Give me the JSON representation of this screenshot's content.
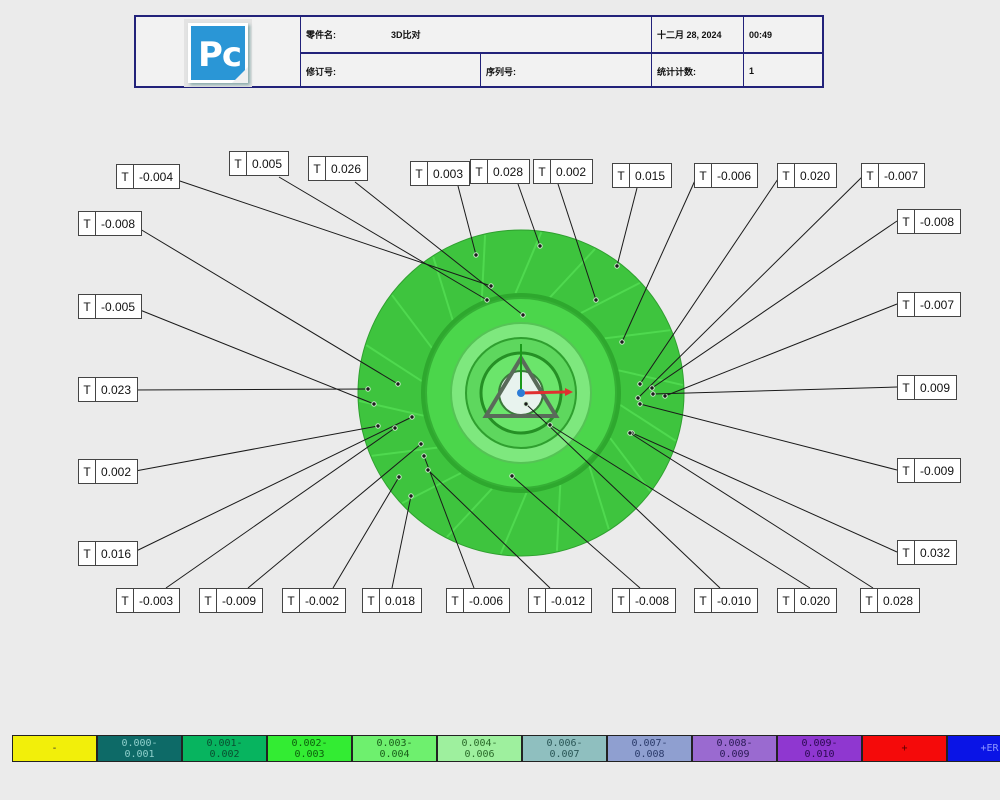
{
  "header": {
    "part_name_label": "零件名:",
    "part_name_value": "3D比对",
    "date": "十二月 28, 2024",
    "time": "00:49",
    "revision_label": "修订号:",
    "serial_label": "序列号:",
    "stat_count_label": "统计计数:",
    "stat_count_value": "1",
    "logo_text": "Pc"
  },
  "callouts": [
    {
      "t": "T",
      "value": "-0.004"
    },
    {
      "t": "T",
      "value": "0.005"
    },
    {
      "t": "T",
      "value": "0.026"
    },
    {
      "t": "T",
      "value": "0.003"
    },
    {
      "t": "T",
      "value": "0.028"
    },
    {
      "t": "T",
      "value": "0.002"
    },
    {
      "t": "T",
      "value": "0.015"
    },
    {
      "t": "T",
      "value": "-0.006"
    },
    {
      "t": "T",
      "value": "0.020"
    },
    {
      "t": "T",
      "value": "-0.007"
    },
    {
      "t": "T",
      "value": "-0.008"
    },
    {
      "t": "T",
      "value": "-0.008"
    },
    {
      "t": "T",
      "value": "-0.005"
    },
    {
      "t": "T",
      "value": "-0.007"
    },
    {
      "t": "T",
      "value": "0.023"
    },
    {
      "t": "T",
      "value": "0.009"
    },
    {
      "t": "T",
      "value": "0.002"
    },
    {
      "t": "T",
      "value": "-0.009"
    },
    {
      "t": "T",
      "value": "0.016"
    },
    {
      "t": "T",
      "value": "0.032"
    },
    {
      "t": "T",
      "value": "-0.003"
    },
    {
      "t": "T",
      "value": "-0.009"
    },
    {
      "t": "T",
      "value": "-0.002"
    },
    {
      "t": "T",
      "value": "0.018"
    },
    {
      "t": "T",
      "value": "-0.006"
    },
    {
      "t": "T",
      "value": "-0.012"
    },
    {
      "t": "T",
      "value": "-0.008"
    },
    {
      "t": "T",
      "value": "-0.010"
    },
    {
      "t": "T",
      "value": "0.020"
    },
    {
      "t": "T",
      "value": "0.028"
    }
  ],
  "legend": [
    {
      "label": "-",
      "color": "#f2ef0a",
      "text_color": "#333333"
    },
    {
      "label": "0.000-\n0.001",
      "color": "#0d6a67",
      "text_color": "#8fd0cc"
    },
    {
      "label": "0.001-\n0.002",
      "color": "#07b45f",
      "text_color": "#0a4e30"
    },
    {
      "label": "0.002-\n0.003",
      "color": "#33ec33",
      "text_color": "#0d5e0d"
    },
    {
      "label": "0.003-\n0.004",
      "color": "#6ef06e",
      "text_color": "#1a5e1a"
    },
    {
      "label": "0.004-\n0.006",
      "color": "#9ef09e",
      "text_color": "#2a6a2a"
    },
    {
      "label": "0.006-\n0.007",
      "color": "#8fbfbf",
      "text_color": "#2a5656"
    },
    {
      "label": "0.007-\n0.008",
      "color": "#8f9fd0",
      "text_color": "#2a3a6a"
    },
    {
      "label": "0.008-\n0.009",
      "color": "#9a6ad0",
      "text_color": "#2a1a55"
    },
    {
      "label": "0.009-\n0.010",
      "color": "#8f37d0",
      "text_color": "#2a0a50"
    },
    {
      "label": "+",
      "color": "#f50a0a",
      "text_color": "#5a0000"
    },
    {
      "label": "+ER",
      "color": "#0a14e6",
      "text_color": "#8d95ff"
    }
  ],
  "colors": {
    "part_outer": "#3ec43e",
    "part_mid": "#4fd94f",
    "part_inner": "#7ee87e",
    "frame": "#22227a"
  }
}
